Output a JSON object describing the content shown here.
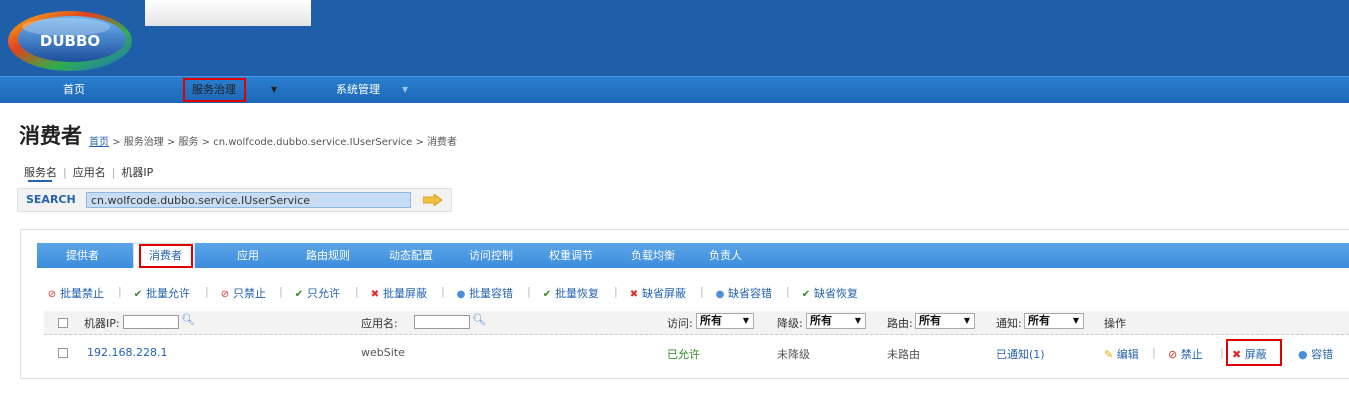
{
  "brand": {
    "logo_text": "DUBBO"
  },
  "nav": {
    "items": [
      {
        "label": "首页"
      },
      {
        "label": "服务治理"
      },
      {
        "label": "系统管理"
      }
    ]
  },
  "page": {
    "title": "消费者",
    "breadcrumb": {
      "home": "首页",
      "rest": " > 服务治理 > 服务 > cn.wolfcode.dubbo.service.IUserService > 消费者"
    }
  },
  "search": {
    "tabs": [
      "服务名",
      "应用名",
      "机器IP"
    ],
    "separator": "|",
    "label": "SEARCH",
    "value": "cn.wolfcode.dubbo.service.IUserService"
  },
  "tabs": [
    "提供者",
    "消费者",
    "应用",
    "路由规则",
    "动态配置",
    "访问控制",
    "权重调节",
    "负载均衡",
    "负责人"
  ],
  "actions": [
    "批量禁止",
    "批量允许",
    "只禁止",
    "只允许",
    "批量屏蔽",
    "批量容错",
    "批量恢复",
    "缺省屏蔽",
    "缺省容错",
    "缺省恢复"
  ],
  "table": {
    "headers": {
      "ip": "机器IP:",
      "app": "应用名:",
      "access": "访问:",
      "degrade": "降级:",
      "route": "路由:",
      "notify": "通知:",
      "ops": "操作"
    },
    "filter_option": "所有",
    "rows": [
      {
        "ip": "192.168.228.1",
        "app": "webSite",
        "access": "已允许",
        "degrade": "未降级",
        "route": "未路由",
        "notify": "已通知(1)",
        "ops": [
          "编辑",
          "禁止",
          "屏蔽",
          "容错"
        ]
      }
    ]
  },
  "colors": {
    "header_bg": "#1f5faa",
    "nav_bg": "#2a7fd0",
    "tab_bar": "#4a98e2",
    "link": "#2563b0",
    "highlight_box": "#e00000",
    "allowed": "#2e8b22"
  }
}
